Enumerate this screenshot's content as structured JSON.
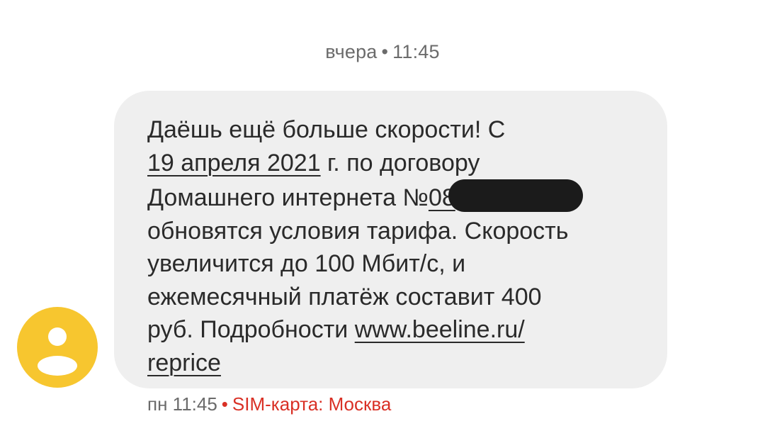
{
  "date_separator": {
    "day": "вчера",
    "dot": "•",
    "time": "11:45"
  },
  "message": {
    "line1": "Даёшь ещё больше скорости! С",
    "date_link": "19 апреля 2021",
    "line2_rest": " г. по договору",
    "line3_text": "Домашнего интернета №",
    "contract_visible": "08",
    "line4": "обновятся условия тарифа. Скорость",
    "line5": "увеличится до 100 Мбит/с, и",
    "line6": "ежемесячный платёж составит 400",
    "line7_text": "руб. Подробности ",
    "url_part1": "www.beeline.ru/",
    "url_part2": "reprice"
  },
  "meta": {
    "time": "пн 11:45",
    "dot": "•",
    "sim": "SIM-карта: Москва"
  },
  "colors": {
    "avatar": "#f7c62f",
    "bubble": "#efefef",
    "sim_label": "#d93025"
  },
  "icons": {
    "avatar": "person-icon"
  }
}
